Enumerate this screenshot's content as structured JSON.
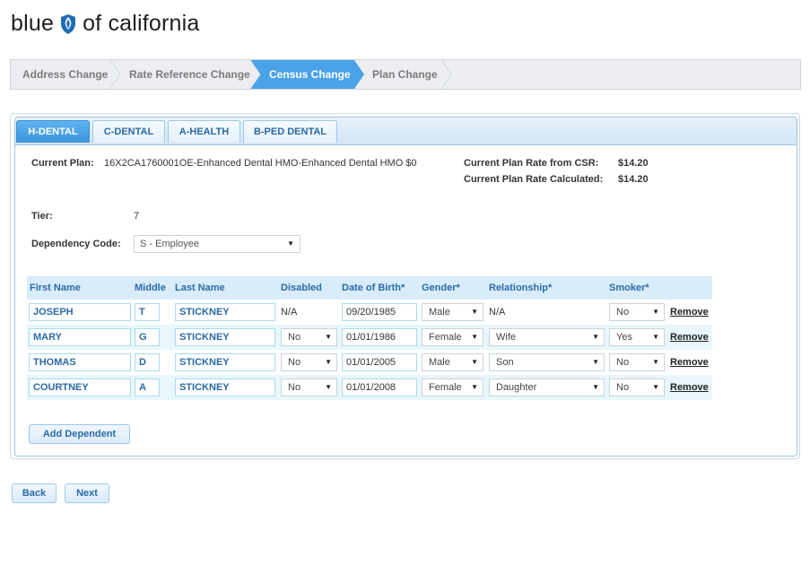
{
  "brand": {
    "left": "blue",
    "right": "of california",
    "color": "#1f6db5"
  },
  "wizard": {
    "steps": [
      {
        "label": "Address Change",
        "active": false
      },
      {
        "label": "Rate Reference Change",
        "active": false
      },
      {
        "label": "Census Change",
        "active": true
      },
      {
        "label": "Plan Change",
        "active": false
      }
    ],
    "active_color": "#4aa3e8"
  },
  "tabs": [
    {
      "label": "H-DENTAL",
      "active": true
    },
    {
      "label": "C-DENTAL",
      "active": false
    },
    {
      "label": "A-HEALTH",
      "active": false
    },
    {
      "label": "B-PED DENTAL",
      "active": false
    }
  ],
  "plan": {
    "current_plan_label": "Current Plan:",
    "current_plan_value": "16X2CA1760001OE-Enhanced Dental HMO-Enhanced Dental HMO $0",
    "rate_csr_label": "Current Plan Rate from CSR:",
    "rate_csr_value": "$14.20",
    "rate_calc_label": "Current Plan Rate Calculated:",
    "rate_calc_value": "$14.20"
  },
  "tier": {
    "label": "Tier:",
    "value": "7"
  },
  "dependency": {
    "label": "Dependency Code:",
    "value": "S - Employee"
  },
  "table": {
    "headers": {
      "first": "First Name",
      "middle": "Middle",
      "last": "Last Name",
      "disabled": "Disabled",
      "dob": "Date of Birth*",
      "gender": "Gender*",
      "relationship": "Relationship*",
      "smoker": "Smoker*"
    },
    "rows": [
      {
        "first": "JOSEPH",
        "middle": "T",
        "last": "STICKNEY",
        "disabled": "N/A",
        "dob": "09/20/1985",
        "gender": "Male",
        "relationship": "N/A",
        "smoker": "No",
        "remove": "Remove"
      },
      {
        "first": "MARY",
        "middle": "G",
        "last": "STICKNEY",
        "disabled": "No",
        "dob": "01/01/1986",
        "gender": "Female",
        "relationship": "Wife",
        "smoker": "Yes",
        "remove": "Remove"
      },
      {
        "first": "THOMAS",
        "middle": "D",
        "last": "STICKNEY",
        "disabled": "No",
        "dob": "01/01/2005",
        "gender": "Male",
        "relationship": "Son",
        "smoker": "No",
        "remove": "Remove"
      },
      {
        "first": "COURTNEY",
        "middle": "A",
        "last": "STICKNEY",
        "disabled": "No",
        "dob": "01/01/2008",
        "gender": "Female",
        "relationship": "Daughter",
        "smoker": "No",
        "remove": "Remove"
      }
    ]
  },
  "buttons": {
    "add_dependent": "Add Dependent",
    "back": "Back",
    "next": "Next"
  },
  "icons": {
    "dropdown": "chevron-down-icon",
    "logo": "shield-icon"
  }
}
